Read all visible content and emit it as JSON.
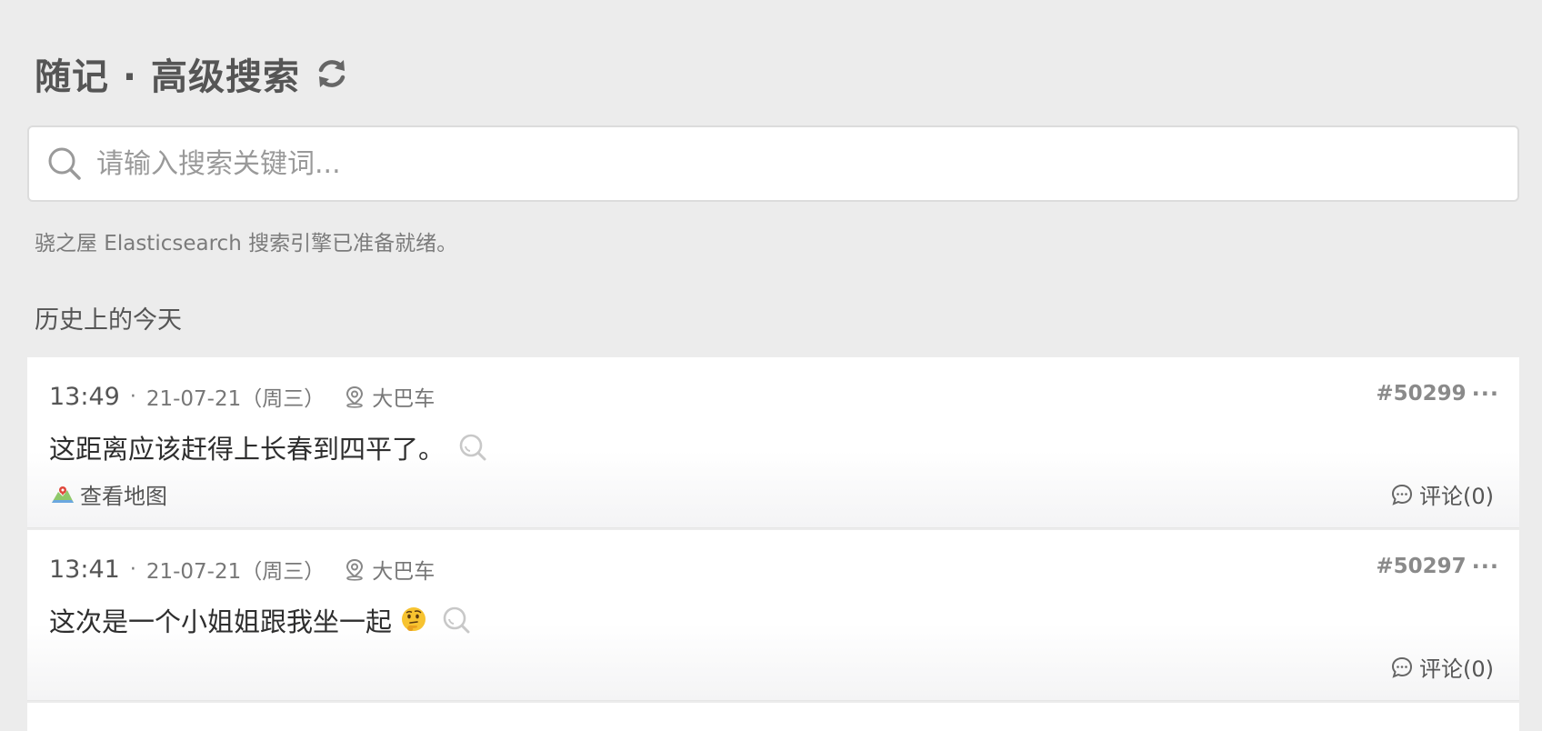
{
  "header": {
    "title": "随记 · 高级搜索",
    "refresh_icon": "refresh-icon"
  },
  "search": {
    "placeholder": "请输入搜索关键词...",
    "value": "",
    "icon": "search-icon"
  },
  "engine_status": "骁之屋 Elasticsearch 搜索引擎已准备就绪。",
  "section_title": "历史上的今天",
  "posts": [
    {
      "time": "13:49",
      "date": "21-07-21（周三）",
      "location": "大巴车",
      "id": "#50299",
      "content": "这距离应该赶得上长春到四平了。",
      "map_link": "查看地图",
      "comments": "评论(0)"
    },
    {
      "time": "13:41",
      "date": "21-07-21（周三）",
      "location": "大巴车",
      "id": "#50297",
      "content": "这次是一个小姐姐跟我坐一起",
      "content_emoji": "thinking-face-emoji",
      "comments": "评论(0)"
    }
  ],
  "colors": {
    "background": "#ececec",
    "card": "#ffffff",
    "text_primary": "#2e2e2e",
    "text_muted": "#777777",
    "icon_gray": "#9a9a9a"
  }
}
